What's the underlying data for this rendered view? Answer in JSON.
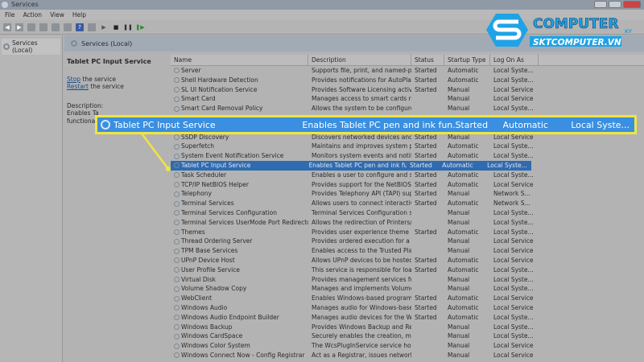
{
  "window": {
    "title": "Services"
  },
  "menu": [
    "File",
    "Action",
    "View",
    "Help"
  ],
  "tree": {
    "root": "Services (Local)"
  },
  "main": {
    "header": "Services (Local)"
  },
  "detail": {
    "title": "Tablet PC Input Service",
    "stop_link": "Stop",
    "stop_rest": " the service",
    "restart_link": "Restart",
    "restart_rest": " the service",
    "description_label": "Description:",
    "description_line1": "Enables Ta",
    "description_line2": "functionali"
  },
  "columns": [
    "Name",
    "Description",
    "Status",
    "Startup Type",
    "Log On As"
  ],
  "rows": [
    [
      "Server",
      "Supports file, print, and named-pi...",
      "Started",
      "Automatic",
      "Local Syste..."
    ],
    [
      "Shell Hardware Detection",
      "Provides notifications for AutoPlay...",
      "Started",
      "Automatic",
      "Local Syste..."
    ],
    [
      "SL UI Notification Service",
      "Provides Software Licensing activa...",
      "Started",
      "Manual",
      "Local Service"
    ],
    [
      "Smart Card",
      "Manages access to smart cards rea...",
      "",
      "Manual",
      "Local Service"
    ],
    [
      "Smart Card Removal Policy",
      "Allows the system to be configure...",
      "",
      "Manual",
      "Local Syste..."
    ],
    null,
    null,
    [
      "SSDP Discovery",
      "Discovers networked devices and s...",
      "Started",
      "Manual",
      "Local Service"
    ],
    [
      "Superfetch",
      "Maintains and improves system pe...",
      "Started",
      "Automatic",
      "Local Syste..."
    ],
    [
      "System Event Notification Service",
      "Monitors system events and notifi...",
      "Started",
      "Automatic",
      "Local Syste..."
    ],
    [
      "Tablet PC Input Service",
      "Enables Tablet PC pen and ink fun...",
      "Started",
      "Automatic",
      "Local Syste..."
    ],
    [
      "Task Scheduler",
      "Enables a user to configure and sc...",
      "Started",
      "Automatic",
      "Local Syste..."
    ],
    [
      "TCP/IP NetBIOS Helper",
      "Provides support for the NetBIOS o...",
      "Started",
      "Automatic",
      "Local Service"
    ],
    [
      "Telephony",
      "Provides Telephony API (TAPI) sup...",
      "Started",
      "Manual",
      "Network S..."
    ],
    [
      "Terminal Services",
      "Allows users to connect interactive...",
      "Started",
      "Automatic",
      "Network S..."
    ],
    [
      "Terminal Services Configuration",
      "Terminal Services Configuration se...",
      "",
      "Manual",
      "Local Syste..."
    ],
    [
      "Terminal Services UserMode Port Redirector",
      "Allows the redirection of Printers/...",
      "",
      "Manual",
      "Local Syste..."
    ],
    [
      "Themes",
      "Provides user experience theme m...",
      "Started",
      "Automatic",
      "Local Syste..."
    ],
    [
      "Thread Ordering Server",
      "Provides ordered execution for a gr...",
      "",
      "Manual",
      "Local Service"
    ],
    [
      "TPM Base Services",
      "Enables access to the Trusted Platf...",
      "",
      "Manual",
      "Local Service"
    ],
    [
      "UPnP Device Host",
      "Allows UPnP devices to be hosted ...",
      "Started",
      "Automatic",
      "Local Service"
    ],
    [
      "User Profile Service",
      "This service is responsible for loadi...",
      "Started",
      "Automatic",
      "Local Syste..."
    ],
    [
      "Virtual Disk",
      "Provides management services for ...",
      "",
      "Manual",
      "Local Syste..."
    ],
    [
      "Volume Shadow Copy",
      "Manages and implements Volume ...",
      "",
      "Manual",
      "Local Syste..."
    ],
    [
      "WebClient",
      "Enables Windows-based programs...",
      "Started",
      "Automatic",
      "Local Service"
    ],
    [
      "Windows Audio",
      "Manages audio for Windows-base...",
      "Started",
      "Automatic",
      "Local Service"
    ],
    [
      "Windows Audio Endpoint Builder",
      "Manages audio devices for the Wi...",
      "Started",
      "Automatic",
      "Local Syste..."
    ],
    [
      "Windows Backup",
      "Provides Windows Backup and Res...",
      "",
      "Manual",
      "Local Syste..."
    ],
    [
      "Windows CardSpace",
      "Securely enables the creation, man...",
      "",
      "Manual",
      "Local Syste..."
    ],
    [
      "Windows Color System",
      "The WcsPlugInService service host...",
      "",
      "Manual",
      "Local Service"
    ],
    [
      "Windows Connect Now - Config Registrar",
      "Act as a Registrar, issues network c...",
      "",
      "Manual",
      "Local Service"
    ]
  ],
  "selected_index": 10,
  "callout": {
    "name": "Tablet PC Input Service",
    "description": "Enables Tablet PC pen and ink fun...",
    "status": "Started",
    "startup": "Automatic",
    "logon": "Local Syste..."
  },
  "logo": {
    "text1": "COMPUTER",
    "text2": "SKTCOMPUTER.VN",
    "suffix": "KY"
  },
  "colors": {
    "accent": "#3a8fe0",
    "highlight": "#f1e440",
    "selection": "#2f6bb0",
    "logo": "#1fa3e6"
  }
}
